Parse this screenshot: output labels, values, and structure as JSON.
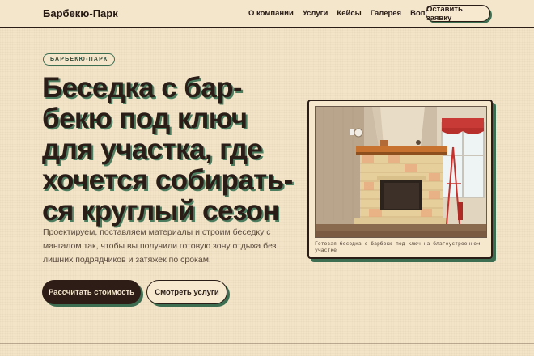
{
  "header": {
    "logo": "Барбекю-Парк",
    "nav": [
      "О компании",
      "Услуги",
      "Кейсы",
      "Галерея",
      "Вопросы"
    ],
    "cta": "Оставить заявку"
  },
  "hero": {
    "tag": "БАРБЕКЮ-ПАРК",
    "title": "Беседка с бар-бекю под ключ для участка, где хочется собирать-ся круглый сезон",
    "title_lines": [
      "Беседка с бар-",
      "бекю под ключ",
      "для участка, где",
      "хочется собирать-",
      "ся круглый сезон"
    ],
    "lead": "Проектируем, поставляем материалы и строим беседку с мангалом так, чтобы вы получили готовую зону отдыха без лишних подрядчиков и затяжек по срокам.",
    "primary_button": "Рассчитать стоимость",
    "secondary_button": "Смотреть услуги"
  },
  "photo_card": {
    "image_icon": "fireplace-photo",
    "caption": "Готовая беседка с барбекю под ключ на благоустроенном участке"
  },
  "colors": {
    "background": "#f3e4c8",
    "ink": "#2a1d18",
    "accent_green": "#3d6e52",
    "primary_button_bg": "#2e1d17"
  }
}
